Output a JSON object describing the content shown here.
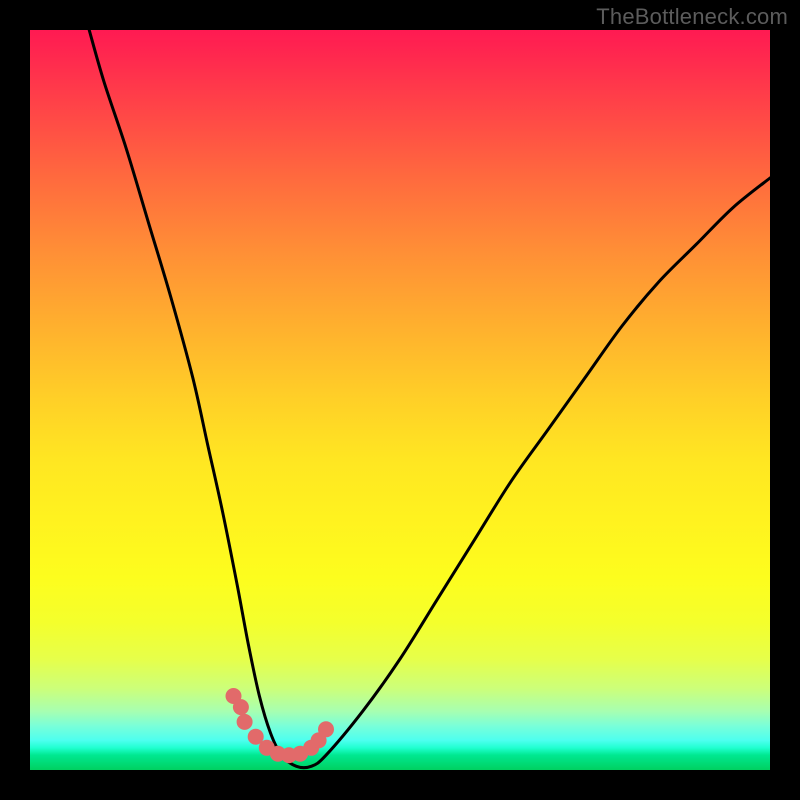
{
  "watermark": "TheBottleneck.com",
  "chart_data": {
    "type": "line",
    "title": "",
    "xlabel": "",
    "ylabel": "",
    "xlim": [
      0,
      100
    ],
    "ylim": [
      0,
      100
    ],
    "series": [
      {
        "name": "bottleneck-curve",
        "x": [
          8,
          10,
          13,
          16,
          19,
          22,
          24,
          26,
          28,
          29.5,
          31,
          32.5,
          34,
          36,
          38,
          40,
          45,
          50,
          55,
          60,
          65,
          70,
          75,
          80,
          85,
          90,
          95,
          100
        ],
        "values": [
          100,
          93,
          84,
          74,
          64,
          53,
          44,
          35,
          25,
          17,
          10,
          5,
          2,
          0.5,
          0.5,
          2,
          8,
          15,
          23,
          31,
          39,
          46,
          53,
          60,
          66,
          71,
          76,
          80
        ]
      },
      {
        "name": "dotted-highlight",
        "x": [
          27.5,
          28.5,
          29,
          30.5,
          32,
          33.5,
          35,
          36.5,
          38,
          39,
          40
        ],
        "values": [
          10,
          8.5,
          6.5,
          4.5,
          3,
          2.2,
          2,
          2.2,
          3,
          4,
          5.5
        ]
      }
    ],
    "colors": {
      "curve": "#000000",
      "dots": "#e26a6a",
      "background_top": "#ff1a52",
      "background_bottom": "#00d060"
    }
  }
}
